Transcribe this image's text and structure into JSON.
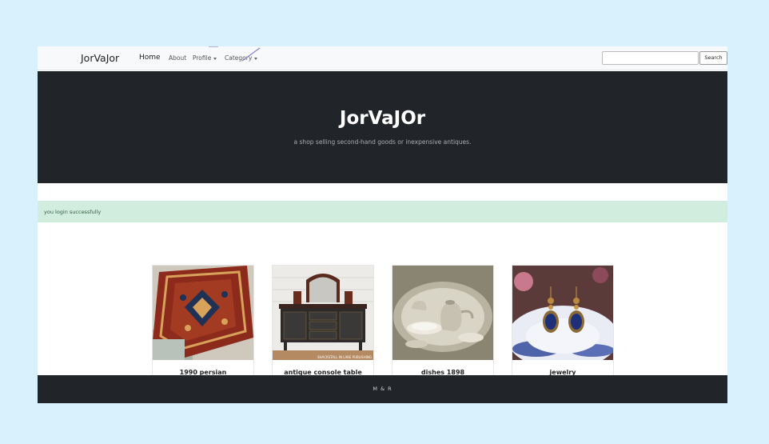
{
  "navbar": {
    "brand": "JorVaJor",
    "home": "Home",
    "about": "About",
    "profile": "Profile",
    "category": "Category",
    "search_placeholder": "",
    "search_button": "Search"
  },
  "hero": {
    "title": "JorVaJOr",
    "subtitle": "a shop selling second-hand goods or inexpensive antiques."
  },
  "alert": {
    "message": "you login successfully"
  },
  "products": [
    {
      "title": "1990 persian",
      "image": "persian-rug-image"
    },
    {
      "title": "antique console table",
      "image": "console-table-image",
      "watermark": "SHACKSTALL IN LAKE PUBLISHING"
    },
    {
      "title": "dishes 1898",
      "image": "silver-dishes-image"
    },
    {
      "title": "jewelry",
      "image": "earrings-image"
    }
  ],
  "footer": {
    "text": "M & R"
  },
  "colors": {
    "page_bg": "#d9f0fd",
    "navbar_bg": "#f8f9fa",
    "hero_bg": "#212529",
    "alert_bg": "#d1eddd",
    "alert_text": "#2e5d3f",
    "footer_bg": "#212529"
  }
}
